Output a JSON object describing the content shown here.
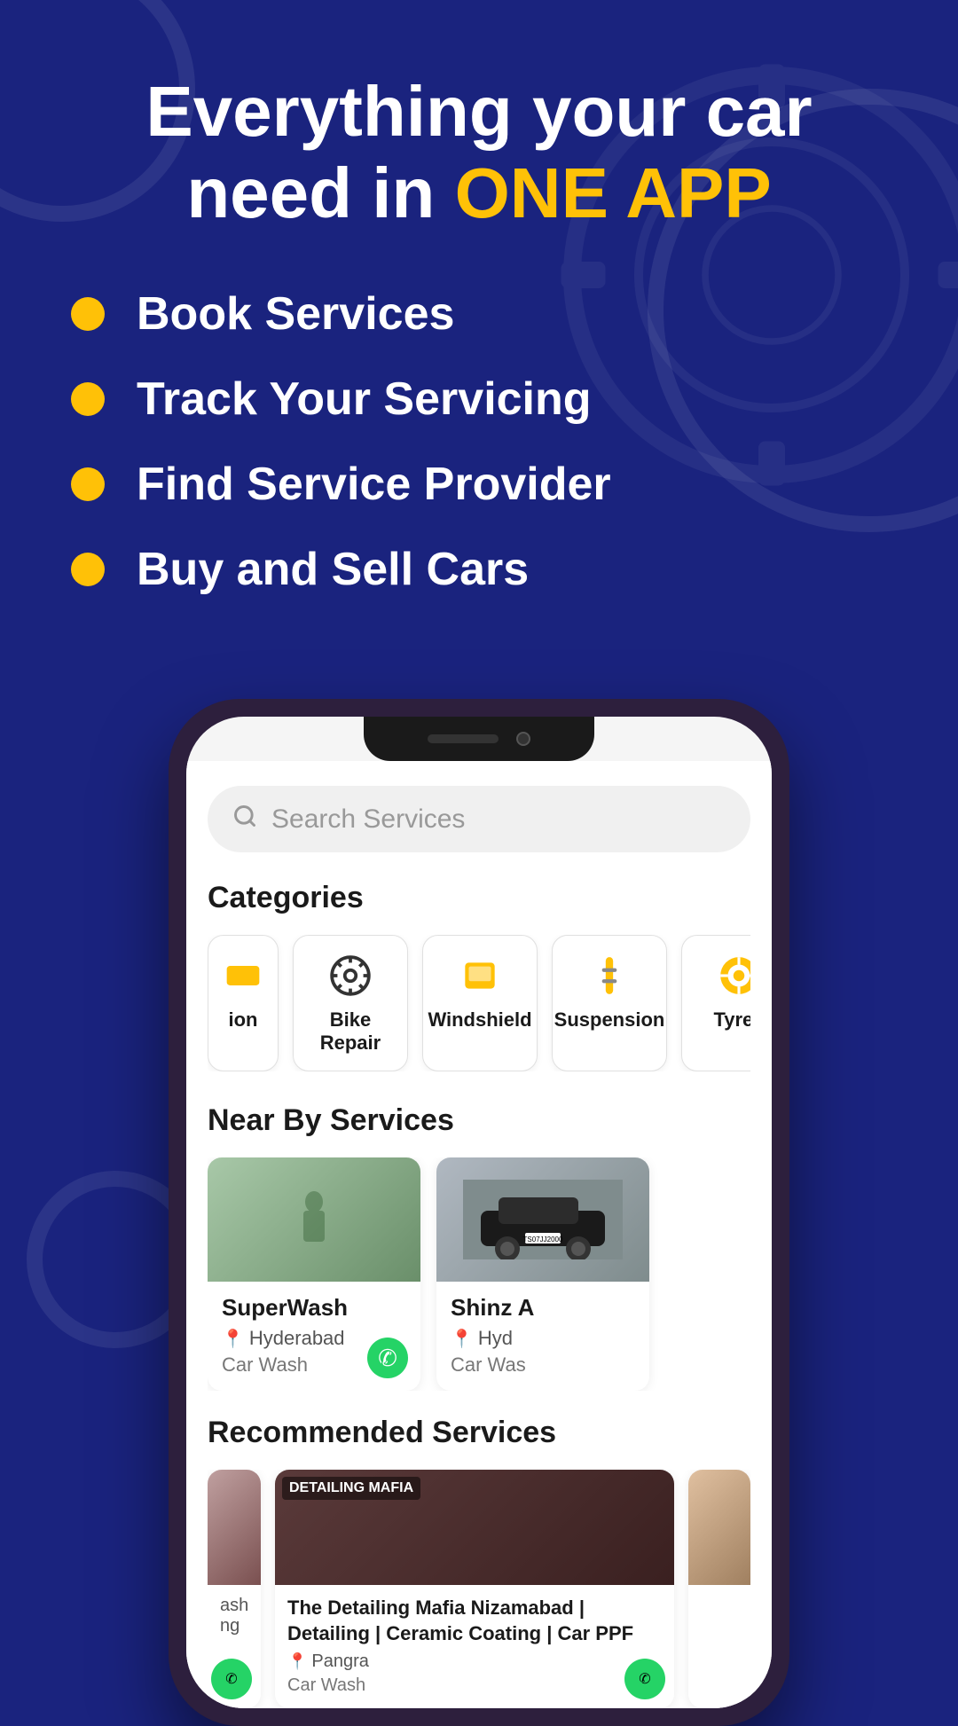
{
  "hero": {
    "title_line1": "Everything your car",
    "title_line2": "need in ",
    "title_highlight": "ONE APP"
  },
  "features": [
    {
      "label": "Book Services"
    },
    {
      "label": "Track Your Servicing"
    },
    {
      "label": "Find Service Provider"
    },
    {
      "label": "Buy and Sell Cars"
    }
  ],
  "phone": {
    "search": {
      "placeholder": "Search Services"
    },
    "categories_title": "Categories",
    "categories": [
      {
        "label": "ion",
        "icon": "partial"
      },
      {
        "label": "Bike Repair",
        "icon": "gear"
      },
      {
        "label": "Windshield",
        "icon": "windshield"
      },
      {
        "label": "Suspension",
        "icon": "suspension"
      },
      {
        "label": "Tyres",
        "icon": "tyres"
      }
    ],
    "nearby_title": "Near By Services",
    "nearby_services": [
      {
        "name": "SuperWash",
        "location": "Hyderabad",
        "type": "Car Wash"
      },
      {
        "name": "Shinz A",
        "location": "Hyd",
        "type": "Car Was"
      }
    ],
    "recommended_title": "Recommended Services",
    "recommended_services": [
      {
        "name": "ash\ning",
        "title": "The Detailing Mafia Nizamabad | Detailing | Ceramic Coating | Car PPF",
        "location": "Pangra",
        "type": "Car Wash"
      },
      {
        "name": "partial",
        "title": "",
        "location": "",
        "type": ""
      }
    ]
  },
  "colors": {
    "background": "#1a237e",
    "highlight": "#FFC107",
    "white": "#ffffff",
    "whatsapp_green": "#25D366"
  }
}
